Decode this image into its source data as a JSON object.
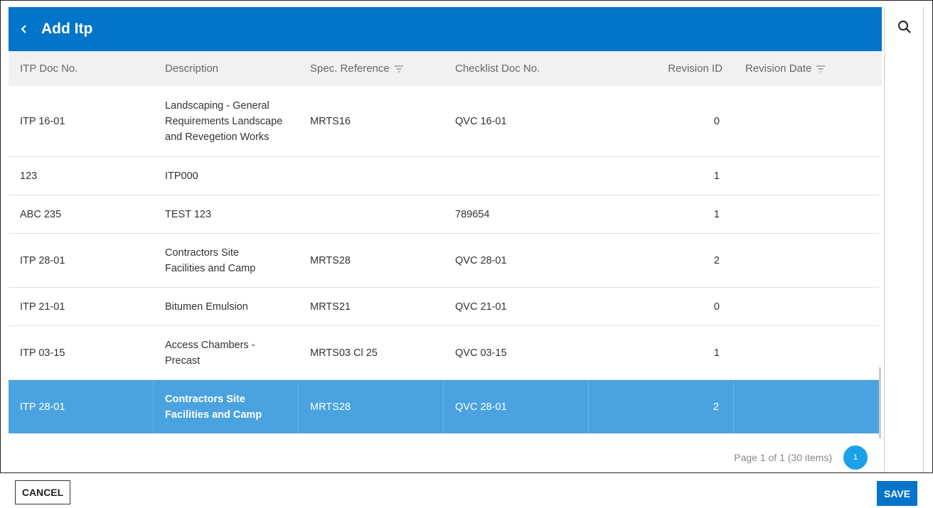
{
  "dialog": {
    "title": "Add Itp"
  },
  "table": {
    "columns": [
      {
        "label": "ITP Doc No.",
        "filter": false
      },
      {
        "label": "Description",
        "filter": false
      },
      {
        "label": "Spec. Reference",
        "filter": true
      },
      {
        "label": "Checklist Doc No.",
        "filter": false
      },
      {
        "label": "Revision ID",
        "filter": false
      },
      {
        "label": "Revision Date",
        "filter": true
      }
    ],
    "rows": [
      {
        "doc": "ITP 16-01",
        "desc": "Landscaping - General Requirements Landscape and Revegetion Works",
        "spec": "MRTS16",
        "checklist": "QVC 16-01",
        "rev": "0",
        "date": ""
      },
      {
        "doc": "123",
        "desc": "ITP000",
        "spec": "",
        "checklist": "",
        "rev": "1",
        "date": ""
      },
      {
        "doc": "ABC 235",
        "desc": "TEST 123",
        "spec": "",
        "checklist": "789654",
        "rev": "1",
        "date": ""
      },
      {
        "doc": "ITP 28-01",
        "desc": "Contractors Site Facilities and Camp",
        "spec": "MRTS28",
        "checklist": "QVC 28-01",
        "rev": "2",
        "date": ""
      },
      {
        "doc": "ITP 21-01",
        "desc": "Bitumen Emulsion",
        "spec": "MRTS21",
        "checklist": "QVC 21-01",
        "rev": "0",
        "date": ""
      },
      {
        "doc": "ITP 03-15",
        "desc": "Access Chambers - Precast",
        "spec": "MRTS03 Cl 25",
        "checklist": "QVC 03-15",
        "rev": "1",
        "date": ""
      },
      {
        "doc": "ITP 28-01",
        "desc": "Contractors Site Facilities and Camp",
        "spec": "MRTS28",
        "checklist": "QVC 28-01",
        "rev": "2",
        "date": "",
        "selected": true
      }
    ]
  },
  "pager": {
    "summary": "Page 1 of 1 (30 items)",
    "current_page": "1"
  },
  "footer": {
    "cancel_label": "CANCEL",
    "save_label": "SAVE"
  },
  "colors": {
    "header_bg": "#0274c9",
    "selected_row": "#4aa3df",
    "page_btn": "#1ba1e8"
  },
  "icons": {
    "back": "chevron-left-icon",
    "filter": "filter-icon",
    "search": "search-icon"
  }
}
